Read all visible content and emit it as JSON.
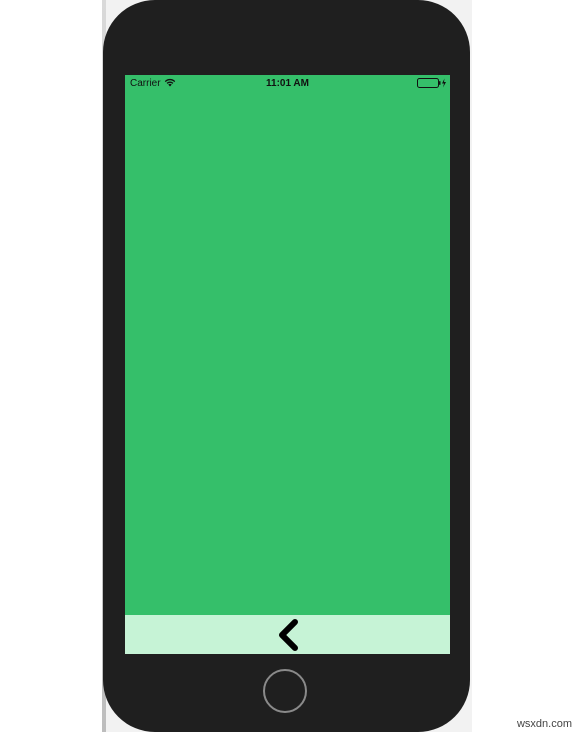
{
  "status_bar": {
    "carrier": "Carrier",
    "time": "11:01 AM",
    "wifi_icon": "wifi-icon",
    "battery_icon": "battery-charging-icon"
  },
  "nav": {
    "back_icon": "chevron-left-icon"
  },
  "colors": {
    "screen_background": "#35bf6a",
    "bottom_bar_background": "#c6f3d6",
    "phone_body": "#1f1f1f",
    "battery_fill": "#35bf6a"
  },
  "watermark": "wsxdn.com"
}
